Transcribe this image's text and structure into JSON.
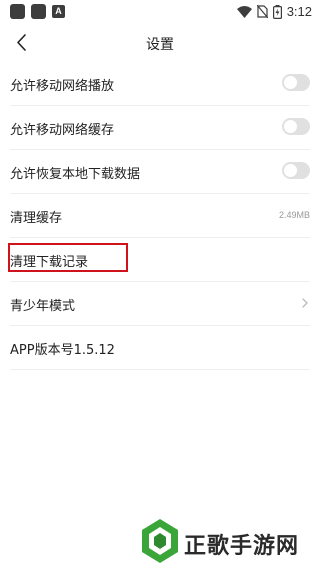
{
  "status_bar": {
    "time": "3:12",
    "left_icons": [
      "app-icon",
      "app-icon",
      "a-badge-icon"
    ],
    "a_badge": "A",
    "right_icons": [
      "wifi-icon",
      "no-sim-icon",
      "battery-charging-icon"
    ]
  },
  "header": {
    "title": "设置",
    "back_icon": "chevron-left-icon"
  },
  "settings": {
    "items": [
      {
        "label": "允许移动网络播放",
        "control": "toggle",
        "enabled": false
      },
      {
        "label": "允许移动网络缓存",
        "control": "toggle",
        "enabled": false
      },
      {
        "label": "允许恢复本地下载数据",
        "control": "toggle",
        "enabled": false
      },
      {
        "label": "清理缓存",
        "control": "value",
        "value": "2.49MB"
      },
      {
        "label": "清理下载记录",
        "control": "none",
        "highlighted": true
      },
      {
        "label": "青少年模式",
        "control": "chevron",
        "icon": "chevron-right-icon"
      },
      {
        "label": "APP版本号1.5.12",
        "control": "none"
      }
    ]
  },
  "colors": {
    "highlight_border": "#d0121b",
    "toggle_off": "#e0e0e0",
    "divider": "#eeeeee",
    "logo_green": "#3aa63a"
  }
}
